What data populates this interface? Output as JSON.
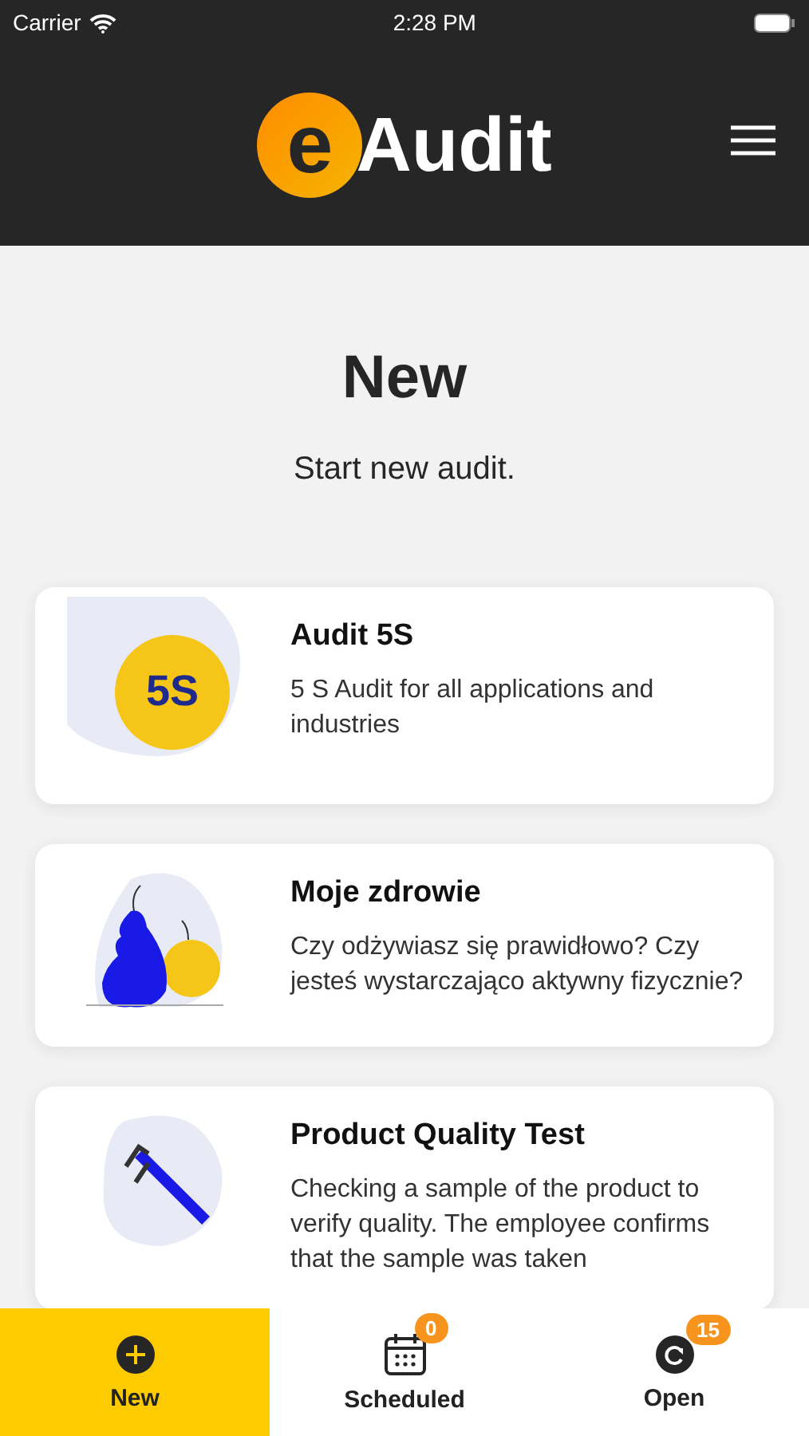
{
  "status_bar": {
    "carrier": "Carrier",
    "time": "2:28 PM"
  },
  "header": {
    "logo_letter": "e",
    "logo_text": "Audit"
  },
  "page": {
    "title": "New",
    "subtitle": "Start new audit."
  },
  "cards": [
    {
      "kind": "badge",
      "badge_text": "5S",
      "title": "Audit 5S",
      "description": "5 S Audit for all applications and industries"
    },
    {
      "kind": "fruit",
      "title": "Moje zdrowie",
      "description": "Czy odżywiasz się prawidłowo? Czy jesteś wystarczająco aktywny fizycznie?"
    },
    {
      "kind": "caliper",
      "title": "Product Quality Test",
      "description": "Checking a sample of the product to verify quality. The employee confirms that the sample was taken"
    }
  ],
  "tabs": [
    {
      "kind": "new",
      "label": "New",
      "selected": true
    },
    {
      "kind": "scheduled",
      "label": "Scheduled",
      "selected": false,
      "badge": "0"
    },
    {
      "kind": "open",
      "label": "Open",
      "selected": false,
      "badge": "15"
    }
  ]
}
